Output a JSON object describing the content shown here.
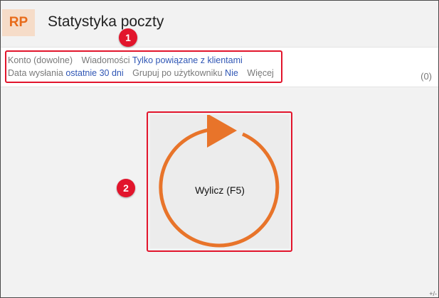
{
  "header": {
    "logo_text": "RP",
    "title": "Statystyka poczty"
  },
  "filters": {
    "row1": [
      {
        "label": "Konto (dowolne)",
        "value": ""
      },
      {
        "label": "Wiadomości",
        "value": "Tylko powiązane z klientami"
      }
    ],
    "row2": [
      {
        "label": "Data wysłania",
        "value": "ostatnie 30 dni"
      },
      {
        "label": "Grupuj po użytkowniku",
        "value": "Nie"
      },
      {
        "label": "Więcej",
        "value": ""
      }
    ],
    "count": "(0)"
  },
  "calculate": {
    "label": "Wylicz (F5)"
  },
  "annotations": {
    "badge1": "1",
    "badge2": "2"
  },
  "corner_mark": "+/-",
  "colors": {
    "accent": "#e8742a",
    "annotation": "#e2152c",
    "link": "#2f56b5"
  }
}
